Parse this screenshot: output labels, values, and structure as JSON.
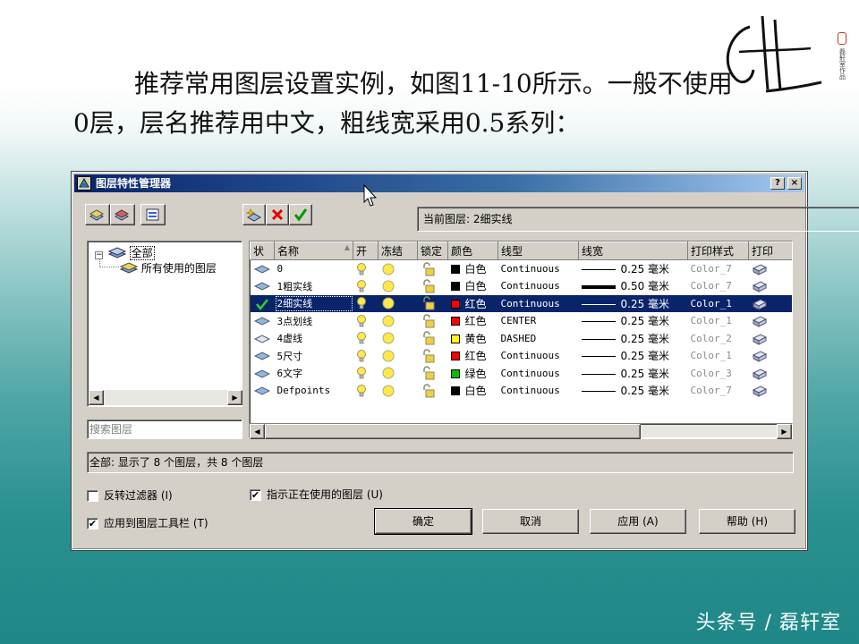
{
  "slide": {
    "line1": "推荐常用图层设置实例，如图11-10所示。一般不使用",
    "line2": "0层，层名推荐用中文，粗线宽采用0.5系列：",
    "stamp_text": "磊轩室作品",
    "watermark": "头条号 / 磊轩室"
  },
  "dialog": {
    "title": "图层特性管理器",
    "help_btn": "?",
    "close_btn": "×",
    "current_layer_label": "当前图层: 2细实线",
    "tree": {
      "root": "全部",
      "child": "所有使用的图层"
    },
    "search_placeholder": "搜索图层",
    "columns": [
      "状",
      "名称",
      "开",
      "冻结",
      "锁定",
      "颜色",
      "线型",
      "线宽",
      "打印样式",
      "打印"
    ],
    "layers": [
      {
        "name": "0",
        "color": "白色",
        "color_hex": "#000000",
        "linetype": "Continuous",
        "lineweight": "0.25 毫米",
        "plot_style": "Color_7"
      },
      {
        "name": "1粗实线",
        "color": "白色",
        "color_hex": "#000000",
        "linetype": "Continuous",
        "lineweight": "0.50 毫米",
        "plot_style": "Color_7"
      },
      {
        "name": "2细实线",
        "color": "红色",
        "color_hex": "#ff0000",
        "linetype": "Continuous",
        "lineweight": "0.25 毫米",
        "plot_style": "Color_1"
      },
      {
        "name": "3点划线",
        "color": "红色",
        "color_hex": "#ff0000",
        "linetype": "CENTER",
        "lineweight": "0.25 毫米",
        "plot_style": "Color_1"
      },
      {
        "name": "4虚线",
        "color": "黄色",
        "color_hex": "#ffff00",
        "linetype": "DASHED",
        "lineweight": "0.25 毫米",
        "plot_style": "Color_2"
      },
      {
        "name": "5尺寸",
        "color": "红色",
        "color_hex": "#ff0000",
        "linetype": "Continuous",
        "lineweight": "0.25 毫米",
        "plot_style": "Color_1"
      },
      {
        "name": "6文字",
        "color": "绿色",
        "color_hex": "#00c000",
        "linetype": "Continuous",
        "lineweight": "0.25 毫米",
        "plot_style": "Color_3"
      },
      {
        "name": "Defpoints",
        "color": "白色",
        "color_hex": "#000000",
        "linetype": "Continuous",
        "lineweight": "0.25 毫米",
        "plot_style": "Color_7"
      }
    ],
    "selected_layer_index": 2,
    "status_text": "全部: 显示了 8 个图层，共 8 个图层",
    "invert_filter_label": "反转过滤器 (I)",
    "invert_filter_checked": false,
    "show_in_use_label": "指示正在使用的图层 (U)",
    "show_in_use_checked": true,
    "apply_toolbar_label": "应用到图层工具栏 (T)",
    "apply_toolbar_checked": true,
    "ok_label": "确定",
    "cancel_label": "取消",
    "apply_label": "应用 (A)",
    "help_label": "帮助 (H)"
  }
}
